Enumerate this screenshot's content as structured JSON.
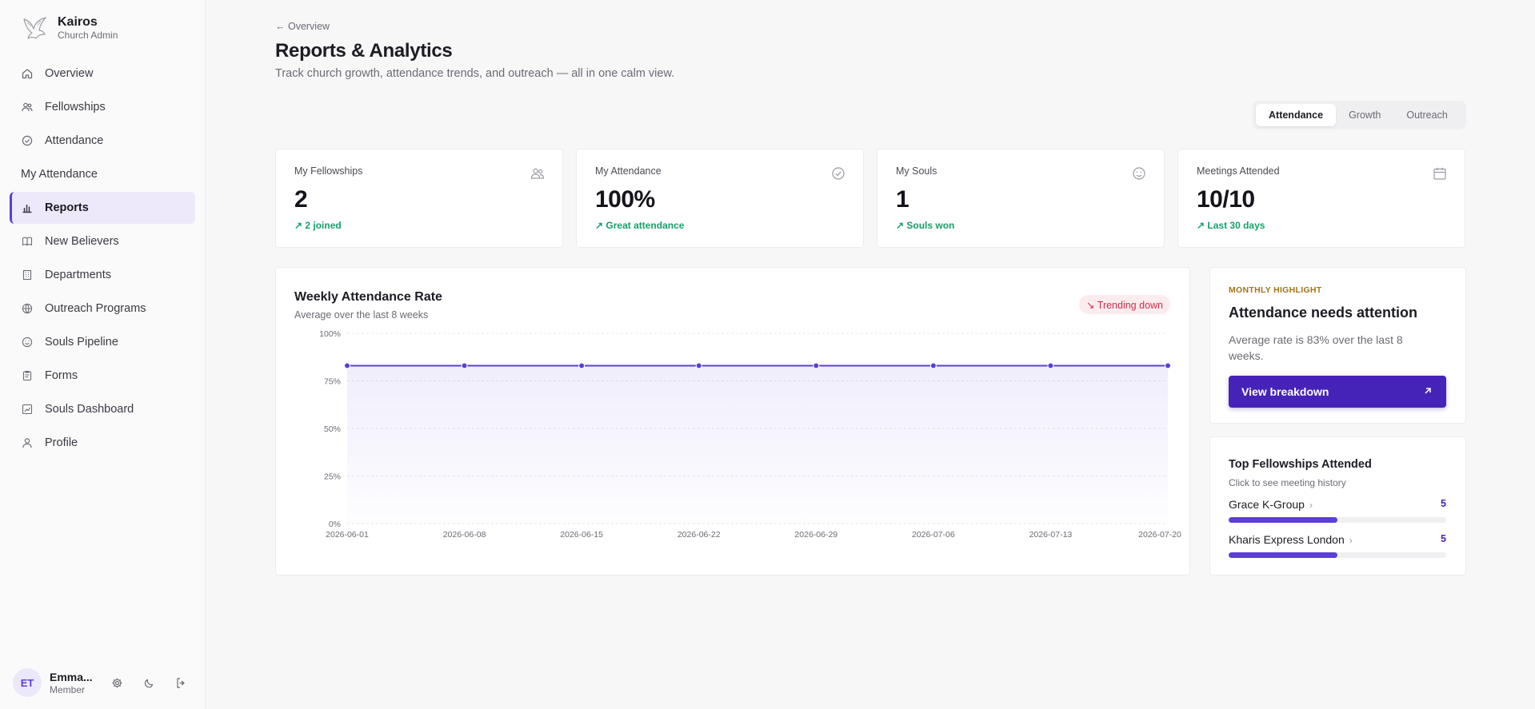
{
  "app": {
    "name": "Kairos",
    "subtitle": "Church Admin"
  },
  "sidebar": {
    "items": [
      {
        "label": "Overview",
        "icon": "home-icon"
      },
      {
        "label": "Fellowships",
        "icon": "users-icon"
      },
      {
        "label": "Attendance",
        "icon": "check-circle-icon"
      },
      {
        "label": "My Attendance",
        "icon": ""
      },
      {
        "label": "Reports",
        "icon": "bar-chart-icon",
        "active": true
      },
      {
        "label": "New Believers",
        "icon": "book-icon"
      },
      {
        "label": "Departments",
        "icon": "building-icon"
      },
      {
        "label": "Outreach Programs",
        "icon": "globe-icon"
      },
      {
        "label": "Souls Pipeline",
        "icon": "smile-icon"
      },
      {
        "label": "Forms",
        "icon": "clipboard-icon"
      },
      {
        "label": "Souls Dashboard",
        "icon": "dashboard-icon"
      },
      {
        "label": "Profile",
        "icon": "user-icon"
      }
    ]
  },
  "user": {
    "initials": "ET",
    "name": "Emma...",
    "role": "Member"
  },
  "header": {
    "back": "← Overview",
    "title": "Reports & Analytics",
    "subtitle": "Track church growth, attendance trends, and outreach — all in one calm view."
  },
  "tabs": [
    "Attendance",
    "Growth",
    "Outreach"
  ],
  "active_tab": "Attendance",
  "stats": [
    {
      "label": "My Fellowships",
      "value": "2",
      "note": "↗ 2 joined",
      "icon": "users-icon"
    },
    {
      "label": "My Attendance",
      "value": "100%",
      "note": "↗ Great attendance",
      "icon": "check-circle-icon"
    },
    {
      "label": "My Souls",
      "value": "1",
      "note": "↗ Souls won",
      "icon": "smile-icon"
    },
    {
      "label": "Meetings Attended",
      "value": "10/10",
      "note": "↗ Last 30 days",
      "icon": "calendar-icon"
    }
  ],
  "chart_card": {
    "title": "Weekly Attendance Rate",
    "subtitle": "Average over the last 8 weeks",
    "badge": "↘ Trending down"
  },
  "chart_data": {
    "type": "area",
    "title": "Weekly Attendance Rate",
    "x": [
      "2026-06-01",
      "2026-06-08",
      "2026-06-15",
      "2026-06-22",
      "2026-06-29",
      "2026-07-06",
      "2026-07-13",
      "2026-07-20"
    ],
    "series": [
      {
        "values": [
          83,
          83,
          83,
          83,
          83,
          83,
          83,
          83
        ]
      }
    ],
    "ylim": [
      0,
      100
    ],
    "yticks": [
      "0%",
      "25%",
      "50%",
      "75%",
      "100%"
    ],
    "grid": true,
    "color": "#5b3fd6"
  },
  "highlight": {
    "eyebrow": "MONTHLY HIGHLIGHT",
    "title": "Attendance needs attention",
    "text": "Average rate is 83% over the last 8 weeks.",
    "button": "View breakdown"
  },
  "top_fellowships": {
    "title": "Top Fellowships Attended",
    "subtitle": "Click to see meeting history",
    "items": [
      {
        "name": "Grace K-Group",
        "count": "5",
        "share": 0.5
      },
      {
        "name": "Kharis Express London",
        "count": "5",
        "share": 0.5
      }
    ]
  },
  "colors": {
    "accent": "#5b3fd6",
    "accent_dark": "#4623b8",
    "positive": "#16a06a",
    "negative": "#d12d4b",
    "eyebrow": "#a5731a"
  }
}
